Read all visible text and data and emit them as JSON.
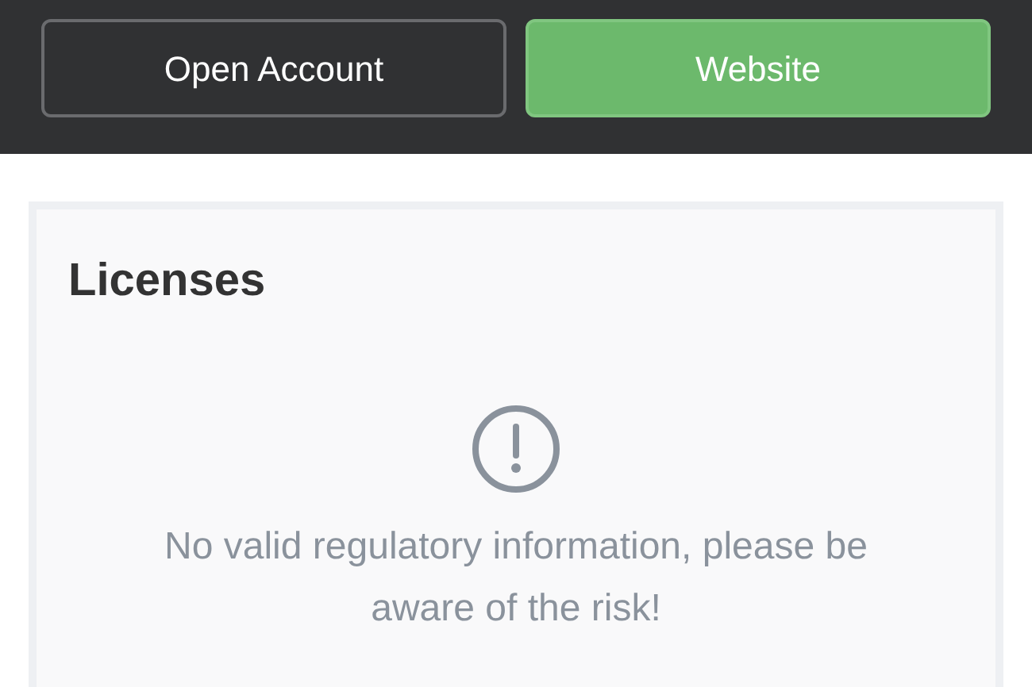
{
  "actions": [
    {
      "label": "Open Account",
      "kind": "outline"
    },
    {
      "label": "Website",
      "kind": "filled"
    }
  ],
  "licenses": {
    "title": "Licenses",
    "empty_message": "No valid regulatory information, please be aware of the risk!"
  }
}
